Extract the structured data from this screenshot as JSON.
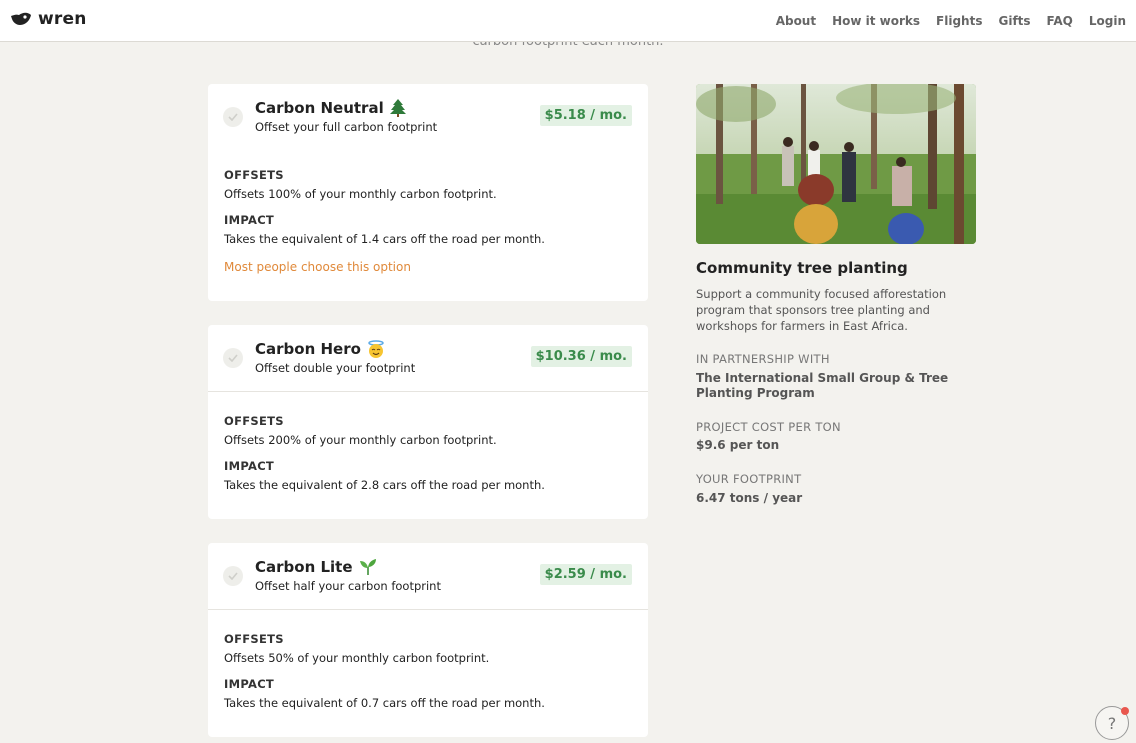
{
  "header": {
    "logo_text": "wren",
    "nav": [
      "About",
      "How it works",
      "Flights",
      "Gifts",
      "FAQ",
      "Login"
    ]
  },
  "intro_tail": "carbon footprint each month.",
  "plans": [
    {
      "name": "Carbon Neutral",
      "emoji": "tree-icon",
      "subtitle": "Offset your full carbon footprint",
      "price": "$5.18 / mo.",
      "offsets_title": "OFFSETS",
      "offsets_text": "Offsets 100% of your monthly carbon footprint.",
      "impact_title": "IMPACT",
      "impact_text": "Takes the equivalent of 1.4 cars off the road per month.",
      "note": "Most people choose this option"
    },
    {
      "name": "Carbon Hero",
      "emoji": "halo-face-icon",
      "subtitle": "Offset double your footprint",
      "price": "$10.36 / mo.",
      "offsets_title": "OFFSETS",
      "offsets_text": "Offsets 200% of your monthly carbon footprint.",
      "impact_title": "IMPACT",
      "impact_text": "Takes the equivalent of 2.8 cars off the road per month."
    },
    {
      "name": "Carbon Lite",
      "emoji": "seedling-icon",
      "subtitle": "Offset half your carbon footprint",
      "price": "$2.59 / mo.",
      "offsets_title": "OFFSETS",
      "offsets_text": "Offsets 50% of your monthly carbon footprint.",
      "impact_title": "IMPACT",
      "impact_text": "Takes the equivalent of 0.7 cars off the road per month."
    }
  ],
  "project": {
    "title": "Community tree planting",
    "description": "Support a community focused afforestation program that sponsors tree planting and workshops for farmers in East Africa.",
    "partnership_label": "IN PARTNERSHIP WITH",
    "partnership_value": "The International Small Group & Tree Planting Program",
    "cost_label": "PROJECT COST PER TON",
    "cost_value": "$9.6 per ton",
    "footprint_label": "YOUR FOOTPRINT",
    "footprint_value": "6.47 tons / year"
  },
  "help_label": "?",
  "colors": {
    "price_green": "#3a8b4b",
    "price_bg": "#e3f1e4",
    "popular_orange": "#e0893a",
    "background": "#f3f2ee"
  }
}
